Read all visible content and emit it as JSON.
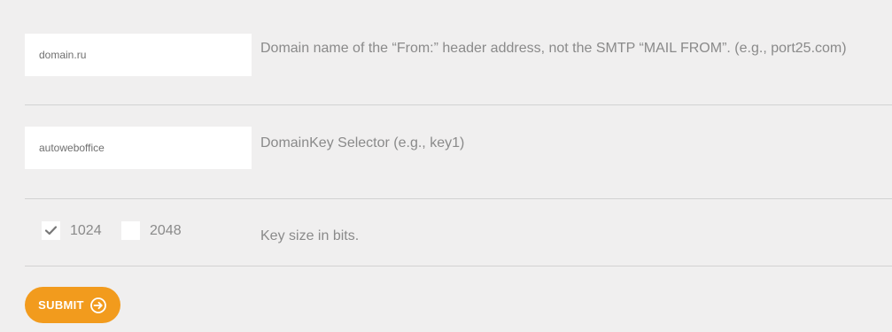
{
  "fields": {
    "domain": {
      "value": "domain.ru",
      "description": "Domain name of the “From:” header address, not the SMTP “MAIL FROM”. (e.g., port25.com)"
    },
    "selector": {
      "value": "autoweboffice",
      "description": "DomainKey Selector (e.g., key1)"
    },
    "key_size": {
      "options": [
        {
          "label": "1024",
          "checked": true
        },
        {
          "label": "2048",
          "checked": false
        }
      ],
      "description": "Key size in bits."
    }
  },
  "submit": {
    "label": "SUBMIT",
    "icon": "arrow-right-circle-icon",
    "color": "#f29b1d"
  }
}
